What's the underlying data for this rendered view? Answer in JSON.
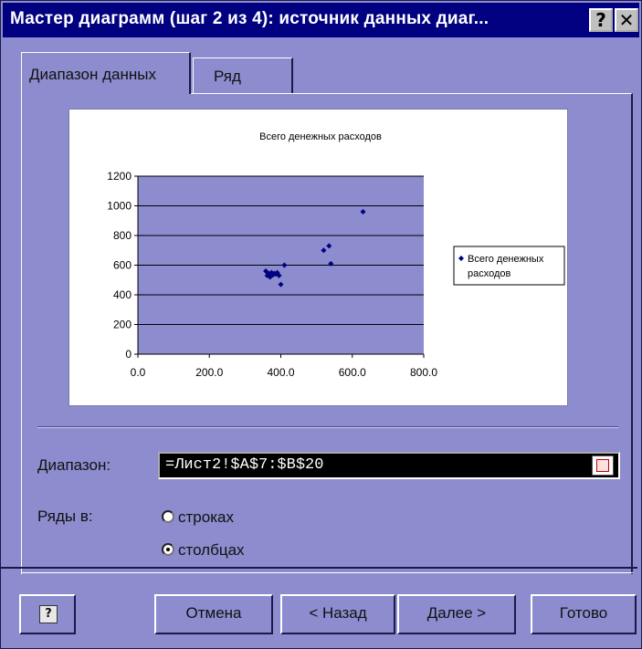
{
  "window": {
    "title": "Мастер диаграмм (шаг 2 из 4): источник данных диаг...",
    "help_glyph": "?",
    "close_glyph": "✕"
  },
  "tabs": [
    {
      "label": "Диапазон данных",
      "active": true
    },
    {
      "label": "Ряд",
      "active": false
    }
  ],
  "chart_data": {
    "type": "scatter",
    "title": "Всего денежных расходов",
    "legend": [
      "Всего денежных",
      "расходов"
    ],
    "legend_position": "right",
    "grid": true,
    "xlim": [
      0,
      800
    ],
    "ylim": [
      0,
      1200
    ],
    "x_ticks": [
      "0.0",
      "200.0",
      "400.0",
      "600.0",
      "800.0"
    ],
    "y_ticks": [
      "0",
      "200",
      "400",
      "600",
      "800",
      "1000",
      "1200"
    ],
    "series": [
      {
        "name": "Всего денежных расходов",
        "color": "#000080",
        "points": [
          [
            358,
            560
          ],
          [
            362,
            530
          ],
          [
            366,
            545
          ],
          [
            370,
            520
          ],
          [
            374,
            550
          ],
          [
            378,
            535
          ],
          [
            382,
            545
          ],
          [
            386,
            540
          ],
          [
            390,
            550
          ],
          [
            395,
            530
          ],
          [
            400,
            470
          ],
          [
            410,
            600
          ],
          [
            520,
            700
          ],
          [
            535,
            730
          ],
          [
            540,
            610
          ],
          [
            630,
            960
          ]
        ]
      }
    ]
  },
  "form": {
    "range_label": "Диапазон:",
    "range_value": "=Лист2!$A$7:$B$20",
    "series_in_label": "Ряды в:",
    "radio_rows": {
      "label": "строках",
      "checked": false
    },
    "radio_cols": {
      "label": "столбцах",
      "checked": true
    }
  },
  "buttons": {
    "help": "?",
    "cancel": "Отмена",
    "back": "< Назад",
    "next": "Далее >",
    "finish": "Готово"
  }
}
